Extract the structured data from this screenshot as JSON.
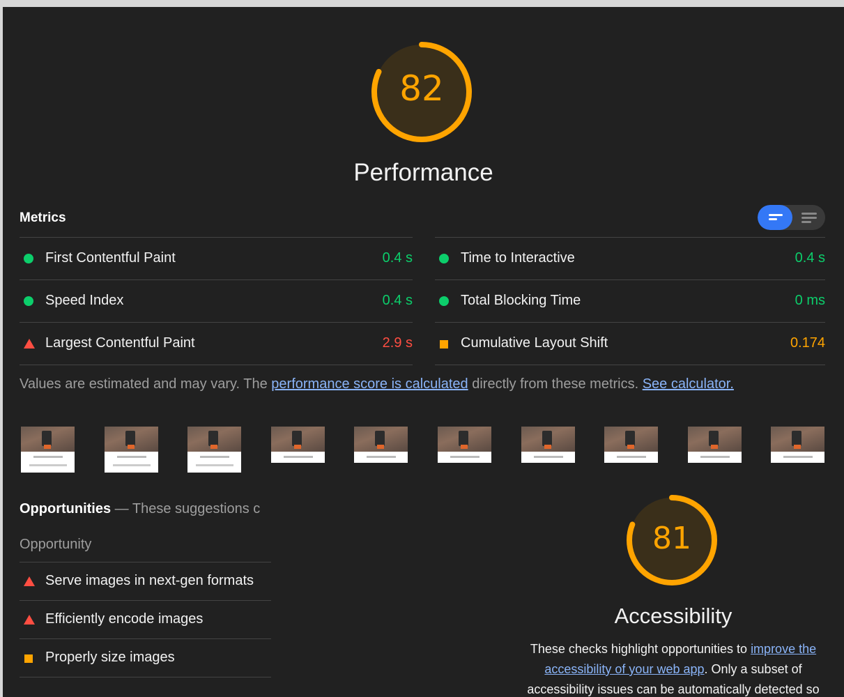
{
  "performance": {
    "score": "82",
    "score_value": 82,
    "title": "Performance",
    "color": "#ffa400"
  },
  "metrics": {
    "header": "Metrics",
    "left": [
      {
        "label": "First Contentful Paint",
        "value": "0.4 s",
        "status": "pass"
      },
      {
        "label": "Speed Index",
        "value": "0.4 s",
        "status": "pass"
      },
      {
        "label": "Largest Contentful Paint",
        "value": "2.9 s",
        "status": "fail"
      }
    ],
    "right": [
      {
        "label": "Time to Interactive",
        "value": "0.4 s",
        "status": "pass"
      },
      {
        "label": "Total Blocking Time",
        "value": "0 ms",
        "status": "pass"
      },
      {
        "label": "Cumulative Layout Shift",
        "value": "0.174",
        "status": "average"
      }
    ],
    "note": {
      "prefix": "Values are estimated and may vary. The ",
      "link1": "performance score is calculated",
      "middle": " directly from these metrics. ",
      "link2": "See calculator."
    }
  },
  "filmstrip": {
    "frame_count": 10
  },
  "opportunities": {
    "header_bold": "Opportunities",
    "header_desc": " — These suggestions c",
    "column_label": "Opportunity",
    "items": [
      {
        "label": "Serve images in next-gen formats",
        "status": "fail"
      },
      {
        "label": "Efficiently encode images",
        "status": "fail"
      },
      {
        "label": "Properly size images",
        "status": "average"
      }
    ]
  },
  "accessibility": {
    "score": "81",
    "score_value": 81,
    "title": "Accessibility",
    "desc_prefix": "These checks highlight opportunities to ",
    "desc_link": "improve the accessibility of your web app",
    "desc_suffix": ". Only a subset of accessibility issues can be automatically detected so"
  },
  "colors": {
    "pass": "#0cce6b",
    "average": "#ffa400",
    "fail": "#ff4e42",
    "link": "#8ab4f8",
    "toggle_active": "#3478f6"
  }
}
